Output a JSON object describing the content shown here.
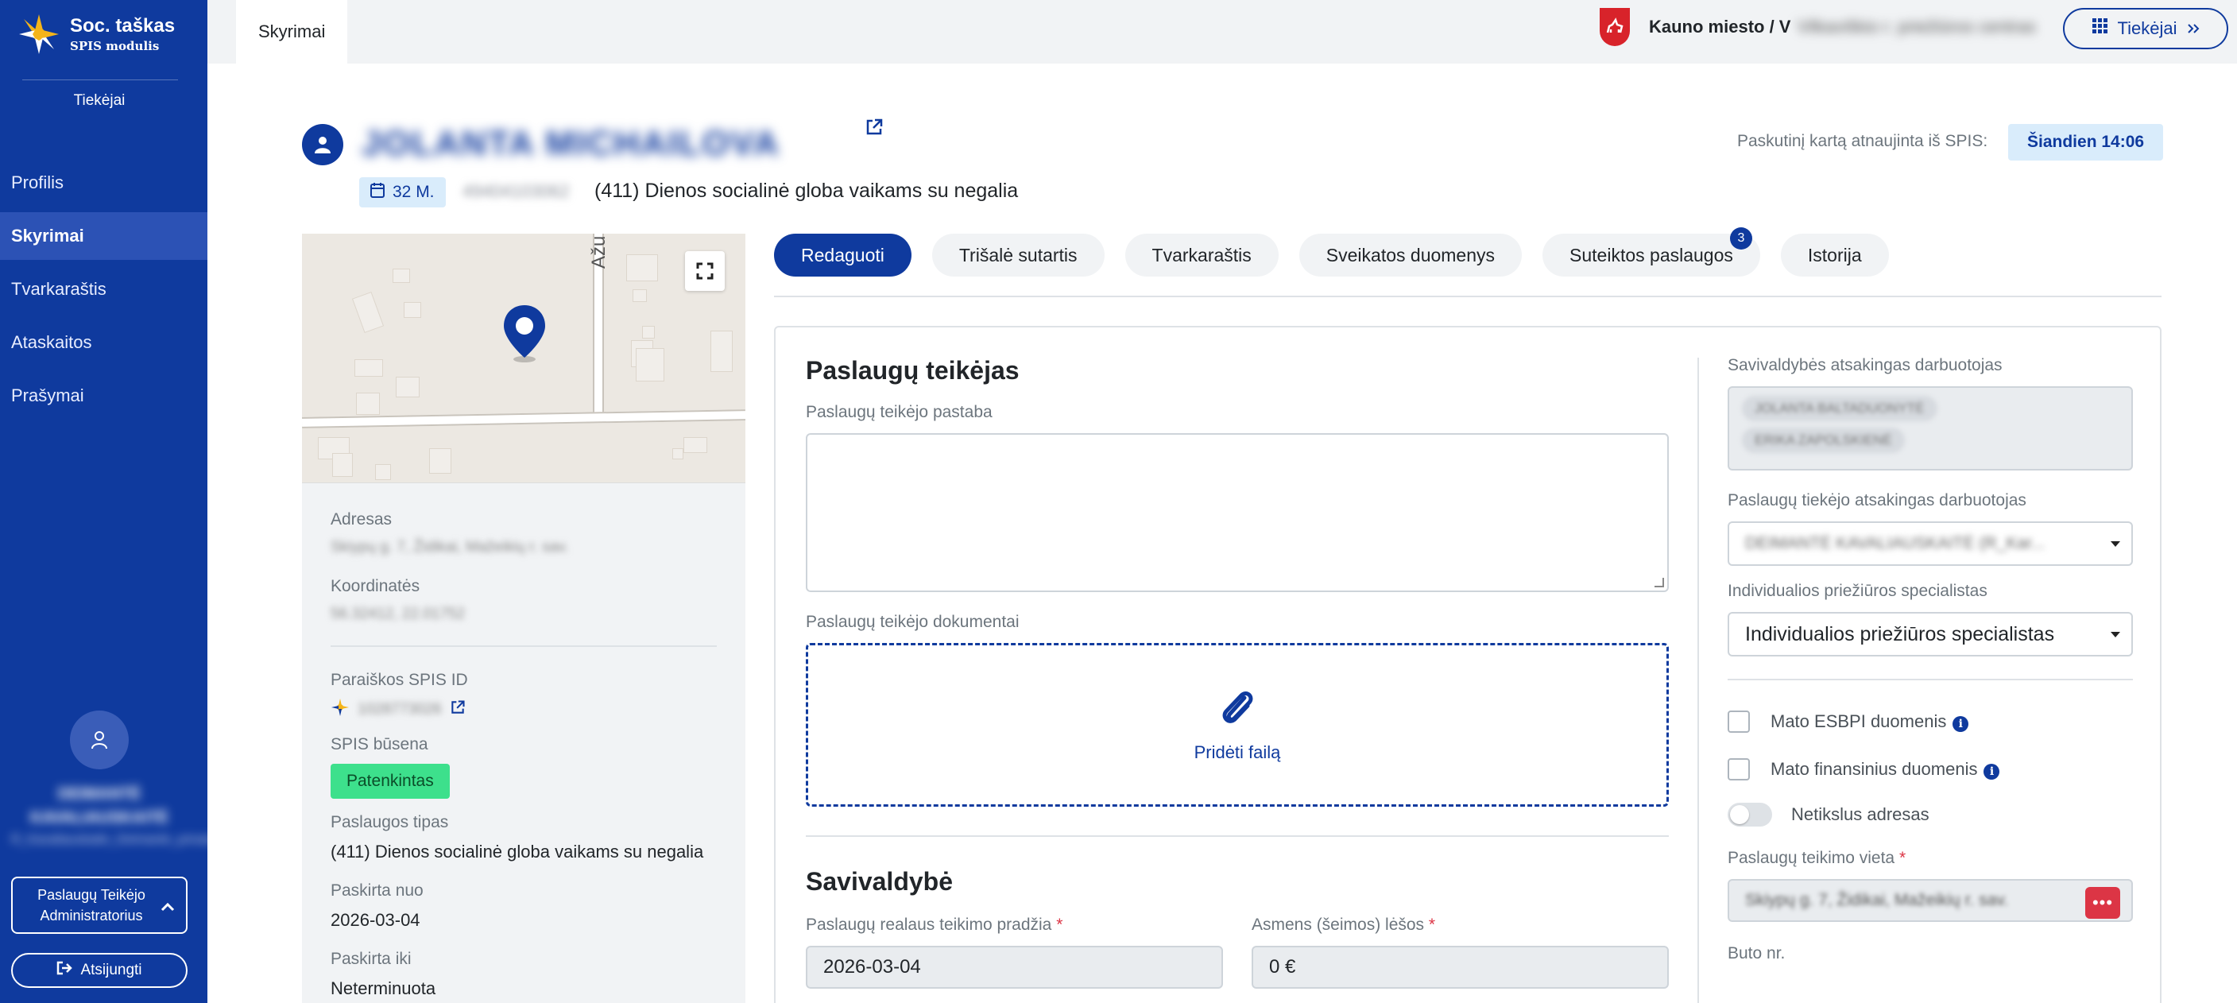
{
  "sidebar": {
    "logo_title": "Soc. taškas",
    "logo_sub": "SPIS modulis",
    "role_title": "Tiekėjai",
    "nav": [
      {
        "label": "Profilis"
      },
      {
        "label": "Skyrimai"
      },
      {
        "label": "Tvarkaraštis"
      },
      {
        "label": "Ataskaitos"
      },
      {
        "label": "Prašymai"
      }
    ],
    "user_name": "DEIMANTĖ KAVALIAUSKAITĖ",
    "user_org": "R_Kavaliauskaitė_Deimantė_privatus",
    "role_button": "Paslaugų Teikėjo Administratorius",
    "logout": "Atsijungti"
  },
  "topbar": {
    "tab": "Skyrimai",
    "municipality": "Kauno miesto / V",
    "municipality_rest": "Vilkaviškio r. priežiūros centras",
    "tiekejai_button": "Tiekėjai"
  },
  "person": {
    "name": "JOLANTA MICHAILOVA",
    "age": "32 M.",
    "code": "49404103062",
    "service": "(411) Dienos socialinė globa vaikams su negalia",
    "updated_label": "Paskutinį kartą atnaujinta iš SPIS:",
    "updated_value": "Šiandien 14:06"
  },
  "map": {
    "street_label": "Ažu"
  },
  "info": {
    "address_label": "Adresas",
    "address_value": "Skiypų g. 7, Židikai, Mažeikių r. sav.",
    "coords_label": "Koordinatės",
    "coords_value": "56.32412, 22.01752",
    "spis_id_label": "Paraiškos SPIS ID",
    "spis_id_value": "1028773026",
    "spis_status_label": "SPIS būsena",
    "spis_status_value": "Patenkintas",
    "service_type_label": "Paslaugos tipas",
    "service_type_value": "(411) Dienos socialinė globa vaikams su negalia",
    "assigned_from_label": "Paskirta nuo",
    "assigned_from_value": "2026-03-04",
    "assigned_to_label": "Paskirta iki",
    "assigned_to_value": "Neterminuota"
  },
  "tabs": [
    {
      "label": "Redaguoti",
      "active": true
    },
    {
      "label": "Trišalė sutartis"
    },
    {
      "label": "Tvarkaraštis"
    },
    {
      "label": "Sveikatos duomenys"
    },
    {
      "label": "Suteiktos paslaugos",
      "count": "3"
    },
    {
      "label": "Istorija"
    }
  ],
  "form": {
    "provider_section_title": "Paslaugų teikėjas",
    "provider_note_label": "Paslaugų teikėjo pastaba",
    "provider_note_value": "",
    "provider_docs_label": "Paslaugų teikėjo dokumentai",
    "add_file": "Pridėti failą",
    "municipality_section_title": "Savivaldybė",
    "start_label": "Paslaugų realaus teikimo pradžia",
    "start_value": "2026-03-04",
    "funds_label": "Asmens (šeimos) lėšos",
    "funds_value": "0 €"
  },
  "right": {
    "muni_staff_label": "Savivaldybės atsakingas darbuotojas",
    "muni_staff": [
      "JOLANTA BALTADUONYTĖ",
      "ERIKA ZAPOLSKIENĖ"
    ],
    "provider_staff_label": "Paslaugų tiekėjo atsakingas darbuotojas",
    "provider_staff_value": "DEIMANTĖ KAVALIAUSKAITĖ (R_Kar...",
    "specialist_label": "Individualios priežiūros specialistas",
    "specialist_value": "Individualios priežiūros specialistas",
    "esbpi_label": "Mato ESBPI duomenis",
    "finance_label": "Mato finansinius duomenis",
    "inaccurate_label": "Netikslus adresas",
    "place_label": "Paslaugų teikimo vieta",
    "place_value": "Skiypų g. 7, Židikai, Mažeikių r. sav.",
    "apt_label": "Buto nr."
  },
  "colors": {
    "primary": "#0f3a9e",
    "status_green": "#3de08c",
    "danger": "#dc3545"
  }
}
